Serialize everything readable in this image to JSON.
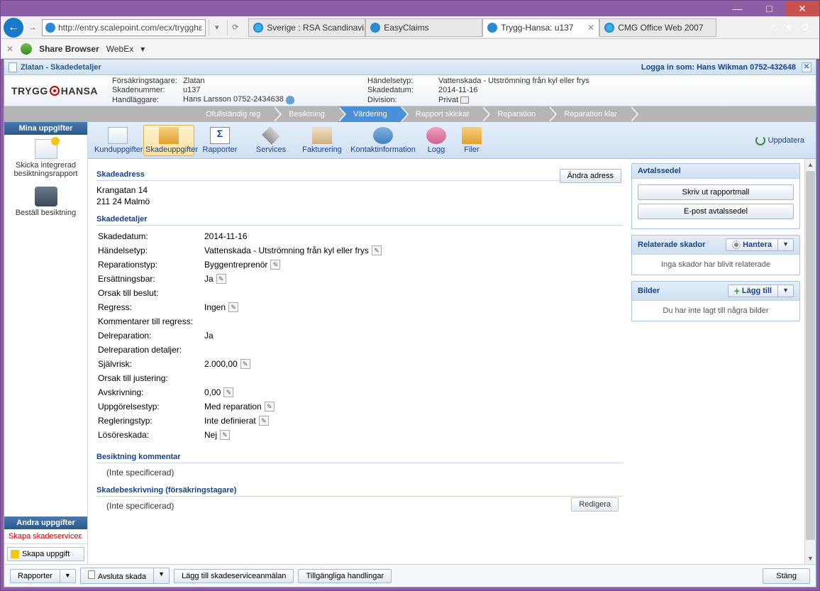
{
  "titlebar": {
    "min": "—",
    "max": "□",
    "close": "✕"
  },
  "nav": {
    "url": "http://entry.scalepoint.com/ecx/trygghε",
    "tabs": [
      {
        "label": "Sverige : RSA Scandinavia",
        "icon": "ie"
      },
      {
        "label": "EasyClaims",
        "icon": "sp"
      },
      {
        "label": "Trygg-Hansa: u137",
        "icon": "sp",
        "active": true
      },
      {
        "label": "CMG Office Web 2007",
        "icon": "ie"
      }
    ]
  },
  "toolbar2": {
    "share": "Share Browser",
    "webex": "WebEx"
  },
  "apptitle": {
    "doc": "Zlatan - Skadedetaljer",
    "login": "Logga in som: Hans Wikman 0752-432648"
  },
  "brand": {
    "name1": "TRYGG",
    "name2": "HANSA"
  },
  "meta": {
    "l1": "Försäkringstagare:",
    "v1": "Zlatan",
    "l2": "Händelsetyp:",
    "v2": "Vattenskada - Utströmning från kyl eller frys",
    "l3": "Skadenummer:",
    "v3": "u137",
    "l4": "Skadedatum:",
    "v4": "2014-11-16",
    "l5": "Handläggare:",
    "v5": "Hans Larsson 0752-2434638",
    "l6": "Division:",
    "v6": "Privat"
  },
  "crumbs": [
    "Ofullständig reg",
    "Besiktning",
    "Värdering",
    "Rapport skickat",
    "Reparation",
    "Reparation klar"
  ],
  "crumb_active_index": 2,
  "left": {
    "hdr1": "Mina uppgifter",
    "item1": "Skicka integrerad besiktningsrapport",
    "item2": "Beställ besiktning",
    "hdr2": "Andra uppgifter",
    "redlink": "Skapa skadeserviceε",
    "skapa": "Skapa uppgift"
  },
  "ribbon": {
    "items": [
      "Kunduppgifter",
      "Skadeuppgifter",
      "Rapporter",
      "Services",
      "Fakturering",
      "Kontaktinformation",
      "Logg",
      "Filer"
    ],
    "sel_index": 1,
    "uppdatera": "Uppdatera"
  },
  "sections": {
    "skadeadress": "Skadeadress",
    "addr1": "Krangatan 14",
    "addr2": "211 24 Malmö",
    "andra_adress": "Ändra adress",
    "skadedetaljer": "Skadedetaljer",
    "kv": {
      "skadedatum_l": "Skadedatum:",
      "skadedatum_v": "2014-11-16",
      "handelsetyp_l": "Händelsetyp:",
      "handelsetyp_v": "Vattenskada - Utströmning från kyl eller frys",
      "reparationstyp_l": "Reparationstyp:",
      "reparationstyp_v": "Byggentreprenör",
      "ersattningsbar_l": "Ersättningsbar:",
      "ersattningsbar_v": "Ja",
      "orsak_l": "Orsak till beslut:",
      "orsak_v": "",
      "regress_l": "Regress:",
      "regress_v": "Ingen",
      "kommentarer_l": "Kommentarer till regress:",
      "kommentarer_v": "",
      "delrep_l": "Delreparation:",
      "delrep_v": "Ja",
      "delrepdet_l": "Delreparation detaljer:",
      "delrepdet_v": "",
      "sjalvrisk_l": "Självrisk:",
      "sjalvrisk_v": "2.000,00",
      "orsakjust_l": "Orsak till justering:",
      "orsakjust_v": "",
      "avskrivning_l": "Avskrivning:",
      "avskrivning_v": "0,00",
      "uppgorelse_l": "Uppgörelsestyp:",
      "uppgorelse_v": "Med reparation",
      "reglering_l": "Regleringstyp:",
      "reglering_v": "Inte definierat",
      "losore_l": "Lösöreskada:",
      "losore_v": "Nej"
    },
    "besiktning_hdr": "Besiktning kommentar",
    "inte_spec": "(Inte specificerad)",
    "skadebeskr_hdr": "Skadebeskrivning (försäkringstagare)",
    "inte_spec2": "(Inte specificerad)",
    "redigera": "Redigera"
  },
  "right": {
    "avtals_hdr": "Avtalssedel",
    "skriv_ut": "Skriv ut rapportmall",
    "epost": "E-post avtalssedel",
    "relaterade_hdr": "Relaterade skador",
    "hantera": "Hantera",
    "inga_skador": "Inga skador har blivit relaterade",
    "bilder_hdr": "Bilder",
    "lagg_till": "Lägg till",
    "inga_bilder": "Du har inte lagt till några bilder"
  },
  "bottom": {
    "rapporter": "Rapporter",
    "avsluta": "Avsluta skada",
    "lagg": "Lägg till skadeserviceanmälan",
    "tillg": "Tillgängliga handlingar",
    "stang": "Stäng"
  }
}
